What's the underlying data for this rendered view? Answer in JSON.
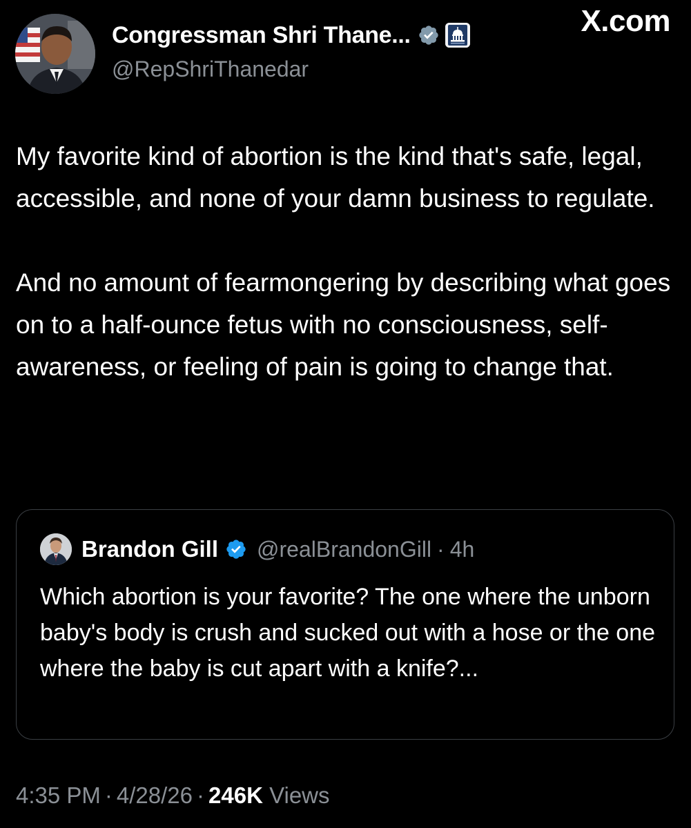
{
  "author": {
    "display_name": "Congressman Shri Thane...",
    "handle": "@RepShriThanedar",
    "avatar": "profile-photo",
    "badges": [
      "verified-badge-icon",
      "government-capitol-badge-icon"
    ]
  },
  "source_label": "X.com",
  "post": {
    "paragraphs": [
      "My favorite kind of abortion is the kind that's safe, legal, accessible, and none of your damn business to regulate.",
      "And no amount of fearmongering by describing what goes on to a half-ounce fetus with no consciousness, self-awareness, or feeling of pain is going to change that."
    ]
  },
  "quoted_post": {
    "display_name": "Brandon Gill",
    "handle": "@realBrandonGill",
    "separator": "·",
    "time_ago": "4h",
    "text": "Which abortion is your favorite? The one where the unborn baby's body is crush and sucked out with a hose or the one where the baby is cut apart with a knife?..."
  },
  "meta": {
    "time": "4:35 PM",
    "date": "4/28/26",
    "views_count": "246K",
    "views_label": "Views",
    "separator": "·"
  },
  "colors": {
    "background": "#000000",
    "primary_text": "#ffffff",
    "secondary_text": "#8b9096",
    "verified_blue": "#1d9bf0",
    "verified_grey": "#829aab",
    "card_border": "#3b3f44"
  }
}
